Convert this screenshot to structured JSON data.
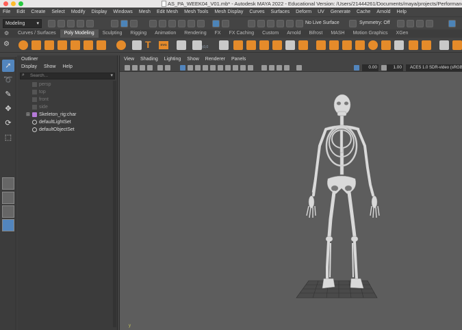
{
  "window": {
    "title": "AS_PA_WEEK04_V01.mb* - Autodesk MAYA 2022 - Educational Version: /Users/21444261/Documents/maya/projects/Performance"
  },
  "menubar": [
    "File",
    "Edit",
    "Create",
    "Select",
    "Modify",
    "Display",
    "Windows",
    "Mesh",
    "Edit Mesh",
    "Mesh Tools",
    "Mesh Display",
    "Curves",
    "Surfaces",
    "Deform",
    "UV",
    "Generate",
    "Cache",
    "Arnold",
    "Help"
  ],
  "status": {
    "mode": "Modeling",
    "live_surface": "No Live Surface",
    "symmetry": "Symmetry: Off"
  },
  "shelf_tabs": [
    "Curves / Surfaces",
    "Poly Modeling",
    "Sculpting",
    "Rigging",
    "Animation",
    "Rendering",
    "FX",
    "FX Caching",
    "Custom",
    "Arnold",
    "Bifrost",
    "MASH",
    "Motion Graphics",
    "XGen"
  ],
  "active_shelf_tab": "Poly Modeling",
  "shelf_text_icons": {
    "text": "T",
    "svg": "SVG",
    "coord": "0,0,0"
  },
  "outliner": {
    "title": "Outliner",
    "menu": [
      "Display",
      "Show",
      "Help"
    ],
    "search_placeholder": "Search...",
    "items": [
      {
        "label": "persp",
        "dim": true,
        "icon": "camera-icon"
      },
      {
        "label": "top",
        "dim": true,
        "icon": "camera-icon"
      },
      {
        "label": "front",
        "dim": true,
        "icon": "camera-icon"
      },
      {
        "label": "side",
        "dim": true,
        "icon": "camera-icon"
      },
      {
        "label": "Skeleton_rig:char",
        "dim": false,
        "icon": "transform-icon",
        "expandable": true
      },
      {
        "label": "defaultLightSet",
        "dim": false,
        "icon": "set-icon"
      },
      {
        "label": "defaultObjectSet",
        "dim": false,
        "icon": "set-icon"
      }
    ]
  },
  "viewport": {
    "menu": [
      "View",
      "Shading",
      "Lighting",
      "Show",
      "Renderer",
      "Panels"
    ],
    "exposure": "0.00",
    "gamma": "1.00",
    "color_space": "ACES 1.0 SDR-video (sRGB)",
    "axis_label": "y"
  },
  "colors": {
    "accent": "#5285bd",
    "shelf_icon": "#e58b2a",
    "viewport_bg": "#5d5d5d",
    "bone": "#d9d9d9"
  }
}
